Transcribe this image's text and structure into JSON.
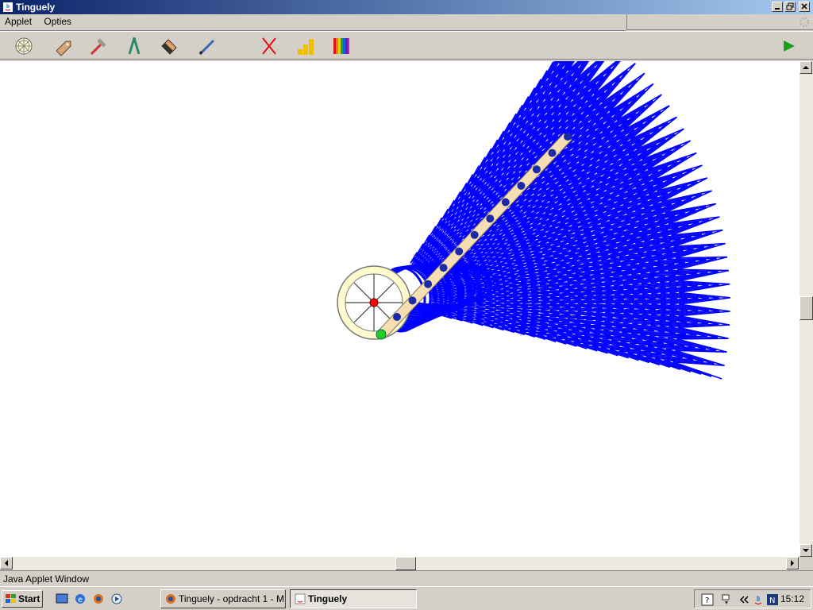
{
  "window": {
    "title": "Tinguely"
  },
  "menu": {
    "items": [
      "Applet",
      "Opties"
    ]
  },
  "toolbar": {
    "tools": [
      "wheel-icon",
      "tag-icon",
      "hammer-icon",
      "compass-icon",
      "eraser-icon",
      "pencil-icon",
      "delete-x-icon",
      "bar-chart-icon",
      "color-palette-icon"
    ],
    "play": "play-icon"
  },
  "status": {
    "text": "Java Applet Window"
  },
  "taskbar": {
    "start_label": "Start",
    "tasks": [
      {
        "label": "Tinguely - opdracht 1 - M...",
        "active": false
      },
      {
        "label": "Tinguely",
        "active": true
      }
    ],
    "clock": "15:12"
  },
  "colors": {
    "pattern": "#0000ff",
    "wheel": "#fffacd",
    "rod": "#f5deb3",
    "pivot_red": "#ff0000",
    "pivot_green": "#22cc22"
  }
}
